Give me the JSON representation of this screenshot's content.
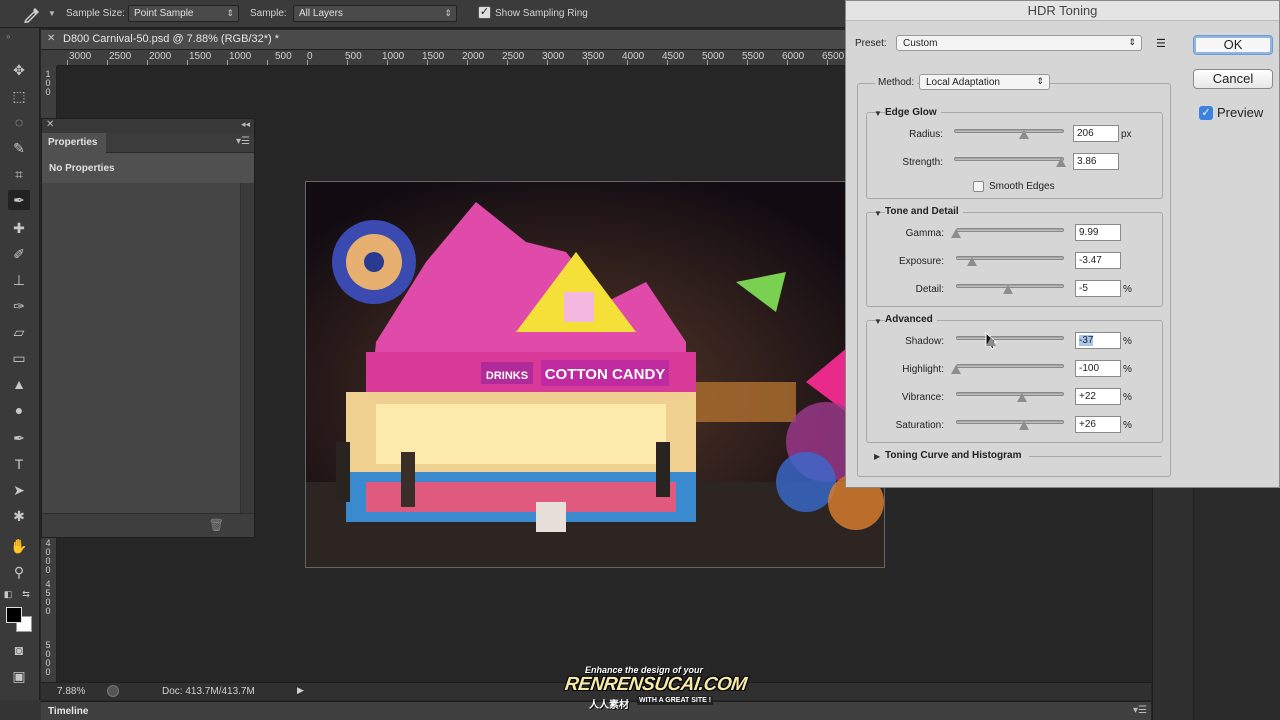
{
  "options_bar": {
    "sample_size_label": "Sample Size:",
    "sample_size_value": "Point Sample",
    "sample_label": "Sample:",
    "sample_value": "All Layers",
    "show_ring_label": "Show Sampling Ring",
    "show_ring_checked": true
  },
  "document": {
    "tab_title": "D800 Carnival-50.psd @ 7.88% (RGB/32*) *",
    "ruler_h": [
      "3000",
      "2500",
      "2000",
      "1500",
      "1000",
      "500",
      "0",
      "500",
      "1000",
      "1500",
      "2000",
      "2500",
      "3000",
      "3500",
      "4000",
      "4500",
      "5000",
      "5500",
      "6000",
      "6500"
    ],
    "ruler_v_top": [
      "1",
      "0",
      "0"
    ],
    "ruler_v_bottom": [
      "4",
      "0",
      "0",
      "0",
      "4",
      "5",
      "0",
      "0",
      "5",
      "0",
      "0",
      "0"
    ]
  },
  "properties": {
    "tab_label": "Properties",
    "empty_text": "No Properties"
  },
  "status": {
    "zoom": "7.88%",
    "doc_size": "Doc: 413.7M/413.7M"
  },
  "timeline": {
    "label": "Timeline"
  },
  "hdr_dialog": {
    "title": "HDR Toning",
    "preset_label": "Preset:",
    "preset_value": "Custom",
    "ok_label": "OK",
    "cancel_label": "Cancel",
    "preview_label": "Preview",
    "preview_checked": true,
    "method_label": "Method:",
    "method_value": "Local Adaptation",
    "edge_glow": {
      "title": "Edge Glow",
      "radius_label": "Radius:",
      "radius_value": "206",
      "radius_unit": "px",
      "radius_fraction": 0.64,
      "strength_label": "Strength:",
      "strength_value": "3.86",
      "strength_fraction": 0.97,
      "smooth_edges_label": "Smooth Edges",
      "smooth_edges_checked": false
    },
    "tone_detail": {
      "title": "Tone and Detail",
      "gamma_label": "Gamma:",
      "gamma_value": "9.99",
      "gamma_fraction": 0.0,
      "exposure_label": "Exposure:",
      "exposure_value": "-3.47",
      "exposure_fraction": 0.15,
      "detail_label": "Detail:",
      "detail_value": "-5",
      "detail_unit": "%",
      "detail_fraction": 0.48
    },
    "advanced": {
      "title": "Advanced",
      "shadow_label": "Shadow:",
      "shadow_value": "-37",
      "shadow_unit": "%",
      "shadow_fraction": 0.32,
      "highlight_label": "Highlight:",
      "highlight_value": "-100",
      "highlight_unit": "%",
      "highlight_fraction": 0.0,
      "vibrance_label": "Vibrance:",
      "vibrance_value": "+22",
      "vibrance_unit": "%",
      "vibrance_fraction": 0.61,
      "saturation_label": "Saturation:",
      "saturation_value": "+26",
      "saturation_unit": "%",
      "saturation_fraction": 0.63
    },
    "toning_curve_title": "Toning Curve and Histogram"
  },
  "canvas_sign": {
    "cotton_candy": "COTTON CANDY",
    "drinks": "DRINKS"
  },
  "watermark": {
    "tagline": "Enhance the design of your",
    "brand": "RENRENSUCAI.COM",
    "chinese": "人人素材",
    "sub": "WITH A GREAT SITE !"
  },
  "colors": {
    "dialog_bg": "#d6d6d6",
    "app_bg": "#262626",
    "accent": "#3b82e0"
  }
}
